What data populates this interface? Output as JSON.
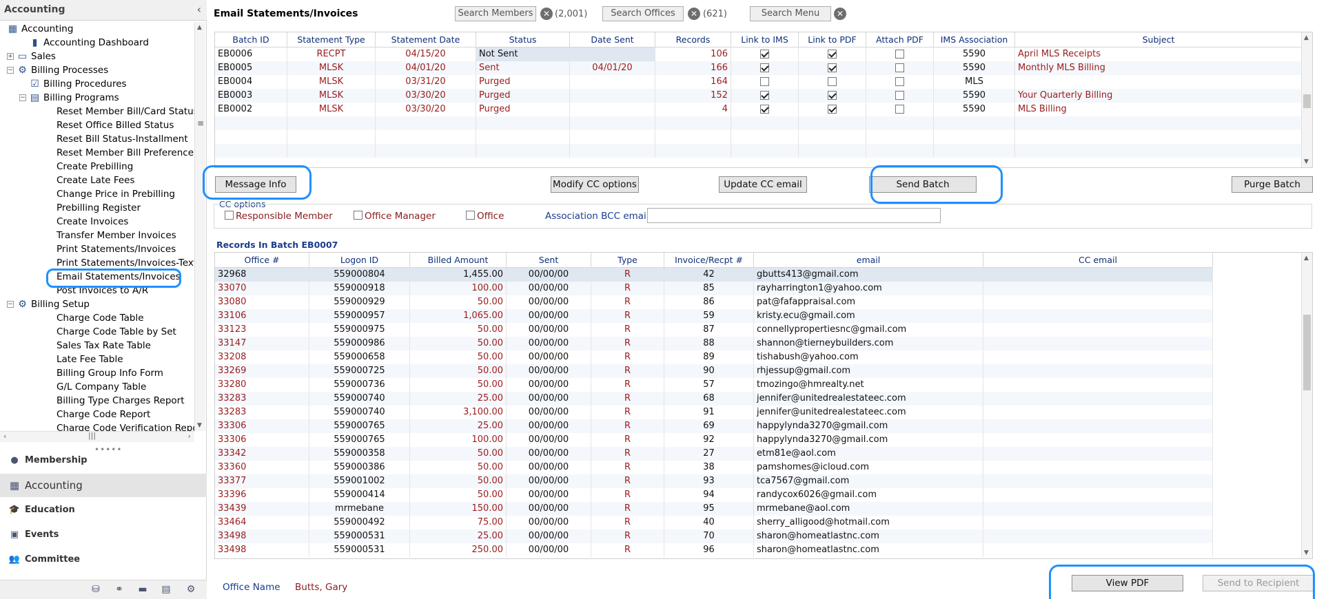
{
  "sidebar": {
    "title": "Accounting",
    "tree": [
      {
        "label": "Accounting",
        "level": 0,
        "icon": "grid-icon",
        "exp": ""
      },
      {
        "label": "Accounting Dashboard",
        "level": 1,
        "icon": "bar-chart-icon",
        "exp": ""
      },
      {
        "label": "Sales",
        "level": 0,
        "icon": "monitor-icon",
        "exp": "+"
      },
      {
        "label": "Billing Processes",
        "level": 0,
        "icon": "gear-process-icon",
        "exp": "−"
      },
      {
        "label": "Billing Procedures",
        "level": 1,
        "icon": "procedure-icon",
        "exp": ""
      },
      {
        "label": "Billing Programs",
        "level": 1,
        "icon": "program-icon",
        "exp": "−"
      },
      {
        "label": "Reset Member Bill/Card Status",
        "level": 2,
        "icon": "",
        "exp": ""
      },
      {
        "label": "Reset Office Billed Status",
        "level": 2,
        "icon": "",
        "exp": ""
      },
      {
        "label": "Reset Bill Status-Installment",
        "level": 2,
        "icon": "",
        "exp": ""
      },
      {
        "label": "Reset Member Bill Preference",
        "level": 2,
        "icon": "",
        "exp": ""
      },
      {
        "label": "Create Prebilling",
        "level": 2,
        "icon": "",
        "exp": ""
      },
      {
        "label": "Create Late Fees",
        "level": 2,
        "icon": "",
        "exp": ""
      },
      {
        "label": "Change Price in Prebilling",
        "level": 2,
        "icon": "",
        "exp": ""
      },
      {
        "label": "Prebilling Register",
        "level": 2,
        "icon": "",
        "exp": ""
      },
      {
        "label": "Create Invoices",
        "level": 2,
        "icon": "",
        "exp": ""
      },
      {
        "label": "Transfer Member Invoices",
        "level": 2,
        "icon": "",
        "exp": ""
      },
      {
        "label": "Print Statements/Invoices",
        "level": 2,
        "icon": "",
        "exp": ""
      },
      {
        "label": "Print Statements/Invoices-Text",
        "level": 2,
        "icon": "",
        "exp": ""
      },
      {
        "label": "Email Statements/Invoices",
        "level": 2,
        "icon": "",
        "exp": "",
        "selected": true
      },
      {
        "label": "Post Invoices to A/R",
        "level": 2,
        "icon": "",
        "exp": ""
      },
      {
        "label": "Billing Setup",
        "level": 0,
        "icon": "gear-icon",
        "exp": "−"
      },
      {
        "label": "Charge Code Table",
        "level": 2,
        "icon": "",
        "exp": ""
      },
      {
        "label": "Charge Code Table by Set",
        "level": 2,
        "icon": "",
        "exp": ""
      },
      {
        "label": "Sales Tax Rate Table",
        "level": 2,
        "icon": "",
        "exp": ""
      },
      {
        "label": "Late Fee Table",
        "level": 2,
        "icon": "",
        "exp": ""
      },
      {
        "label": "Billing Group Info Form",
        "level": 2,
        "icon": "",
        "exp": ""
      },
      {
        "label": "G/L Company Table",
        "level": 2,
        "icon": "",
        "exp": ""
      },
      {
        "label": "Billing Type Charges Report",
        "level": 2,
        "icon": "",
        "exp": ""
      },
      {
        "label": "Charge Code Report",
        "level": 2,
        "icon": "",
        "exp": ""
      },
      {
        "label": "Charge Code Verification Report",
        "level": 2,
        "icon": "",
        "exp": ""
      }
    ],
    "modules": [
      {
        "label": "Membership",
        "icon": "membership-icon",
        "glyph": "●"
      },
      {
        "label": "Accounting",
        "icon": "accounting-icon",
        "glyph": "▦",
        "active": true
      },
      {
        "label": "Education",
        "icon": "education-icon",
        "glyph": "🎓"
      },
      {
        "label": "Events",
        "icon": "events-icon",
        "glyph": "▣"
      },
      {
        "label": "Committee",
        "icon": "committee-icon",
        "glyph": "👥"
      }
    ]
  },
  "header": {
    "title": "Email Statements/Invoices",
    "search_members": "Search Members",
    "members_count": "(2,001)",
    "search_offices": "Search Offices",
    "offices_count": "(621)",
    "search_menu": "Search Menu"
  },
  "batches": {
    "columns": [
      "Batch ID",
      "Statement Type",
      "Statement Date",
      "Status",
      "Date Sent",
      "Records",
      "Link to IMS",
      "Link to PDF",
      "Attach PDF",
      "IMS Association",
      "Subject"
    ],
    "rows": [
      {
        "id": "EB0006",
        "type": "RECPT",
        "date": "04/15/20",
        "status": "Not Sent",
        "sent": "",
        "records": "106",
        "ims": true,
        "pdf": true,
        "attach": false,
        "assoc": "5590",
        "subject": "April MLS Receipts"
      },
      {
        "id": "EB0005",
        "type": "MLSK",
        "date": "04/01/20",
        "status": "Sent",
        "sent": "04/01/20",
        "records": "166",
        "ims": true,
        "pdf": true,
        "attach": false,
        "assoc": "5590",
        "subject": "Monthly MLS Billing"
      },
      {
        "id": "EB0004",
        "type": "MLSK",
        "date": "03/31/20",
        "status": "Purged",
        "sent": "",
        "records": "164",
        "ims": false,
        "pdf": false,
        "attach": false,
        "assoc": "MLS",
        "subject": ""
      },
      {
        "id": "EB0003",
        "type": "MLSK",
        "date": "03/30/20",
        "status": "Purged",
        "sent": "",
        "records": "152",
        "ims": true,
        "pdf": true,
        "attach": false,
        "assoc": "5590",
        "subject": "Your Quarterly Billing"
      },
      {
        "id": "EB0002",
        "type": "MLSK",
        "date": "03/30/20",
        "status": "Purged",
        "sent": "",
        "records": "4",
        "ims": true,
        "pdf": true,
        "attach": false,
        "assoc": "5590",
        "subject": "MLS Billing"
      }
    ]
  },
  "actions": {
    "message_info": "Message Info",
    "modify_cc": "Modify CC options",
    "update_cc": "Update CC email",
    "send_batch": "Send Batch",
    "purge_batch": "Purge Batch"
  },
  "cc_options": {
    "title": "CC options",
    "responsible_member": "Responsible Member",
    "office_manager": "Office Manager",
    "office": "Office",
    "bcc_label": "Association BCC email",
    "bcc_value": ""
  },
  "records": {
    "title": "Records In Batch EB0007",
    "columns": [
      "Office #",
      "Logon ID",
      "Billed Amount",
      "Sent",
      "Type",
      "Invoice/Recpt #",
      "email",
      "CC email"
    ],
    "rows": [
      [
        "32968",
        "559000804",
        "1,455.00",
        "00/00/00",
        "R",
        "42",
        "gbutts413@gmail.com",
        ""
      ],
      [
        "33070",
        "559000918",
        "100.00",
        "00/00/00",
        "R",
        "85",
        "rayharrington1@yahoo.com",
        ""
      ],
      [
        "33080",
        "559000929",
        "50.00",
        "00/00/00",
        "R",
        "86",
        "pat@fafappraisal.com",
        ""
      ],
      [
        "33106",
        "559000957",
        "1,065.00",
        "00/00/00",
        "R",
        "59",
        "kristy.ecu@gmail.com",
        ""
      ],
      [
        "33123",
        "559000975",
        "50.00",
        "00/00/00",
        "R",
        "87",
        "connellypropertiesnc@gmail.com",
        ""
      ],
      [
        "33147",
        "559000986",
        "50.00",
        "00/00/00",
        "R",
        "88",
        "shannon@tierneybuilders.com",
        ""
      ],
      [
        "33208",
        "559000658",
        "50.00",
        "00/00/00",
        "R",
        "89",
        "tishabush@yahoo.com",
        ""
      ],
      [
        "33269",
        "559000725",
        "50.00",
        "00/00/00",
        "R",
        "90",
        "rhjessup@gmail.com",
        ""
      ],
      [
        "33280",
        "559000736",
        "50.00",
        "00/00/00",
        "R",
        "57",
        "tmozingo@hmrealty.net",
        ""
      ],
      [
        "33283",
        "559000740",
        "25.00",
        "00/00/00",
        "R",
        "68",
        "jennifer@unitedrealestateec.com",
        ""
      ],
      [
        "33283",
        "559000740",
        "3,100.00",
        "00/00/00",
        "R",
        "91",
        "jennifer@unitedrealestateec.com",
        ""
      ],
      [
        "33306",
        "559000765",
        "25.00",
        "00/00/00",
        "R",
        "69",
        "happylynda3270@gmail.com",
        ""
      ],
      [
        "33306",
        "559000765",
        "100.00",
        "00/00/00",
        "R",
        "92",
        "happylynda3270@gmail.com",
        ""
      ],
      [
        "33342",
        "559000358",
        "50.00",
        "00/00/00",
        "R",
        "27",
        "etm81e@aol.com",
        ""
      ],
      [
        "33360",
        "559000386",
        "50.00",
        "00/00/00",
        "R",
        "38",
        "pamshomes@icloud.com",
        ""
      ],
      [
        "33377",
        "559001002",
        "50.00",
        "00/00/00",
        "R",
        "93",
        "tca7567@gmail.com",
        ""
      ],
      [
        "33396",
        "559000414",
        "50.00",
        "00/00/00",
        "R",
        "94",
        "randycox6026@gmail.com",
        ""
      ],
      [
        "33439",
        "mrmebane",
        "150.00",
        "00/00/00",
        "R",
        "95",
        "mrmebane@aol.com",
        ""
      ],
      [
        "33464",
        "559000492",
        "75.00",
        "00/00/00",
        "R",
        "40",
        "sherry_alligood@hotmail.com",
        ""
      ],
      [
        "33498",
        "559000531",
        "25.00",
        "00/00/00",
        "R",
        "70",
        "sharon@homeatlastnc.com",
        ""
      ],
      [
        "33498",
        "559000531",
        "250.00",
        "00/00/00",
        "R",
        "96",
        "sharon@homeatlastnc.com",
        ""
      ]
    ]
  },
  "footer": {
    "office_name_label": "Office Name",
    "office_name_value": "Butts, Gary",
    "view_pdf": "View PDF",
    "send_recipient": "Send to Recipient"
  },
  "colors": {
    "accent": "#1e90ff",
    "dark_red": "#9a1c1c",
    "header_blue": "#0e2f7a"
  }
}
